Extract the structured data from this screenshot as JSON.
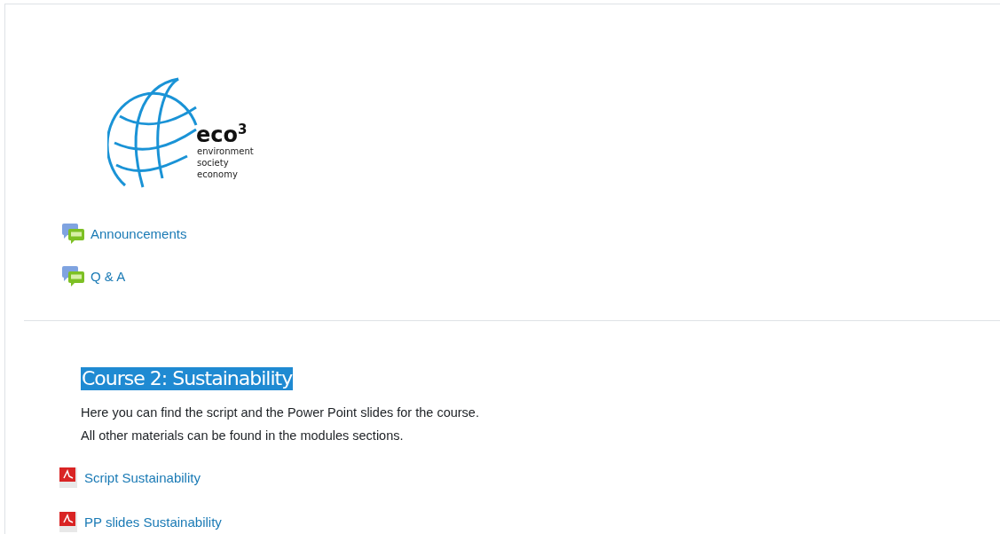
{
  "logo": {
    "name": "eco",
    "superscript": "3",
    "lines": [
      "environment",
      "society",
      "economy"
    ]
  },
  "forum_links": [
    {
      "kind": "forum",
      "label": "Announcements"
    },
    {
      "kind": "forum",
      "label": "Q & A"
    }
  ],
  "section": {
    "title": "Course 2: Sustainability",
    "selected": true,
    "summary": [
      "Here you can find the script and the Power Point slides for the course.",
      "All other materials can be found in the modules sections."
    ],
    "files": [
      {
        "kind": "pdf",
        "label": "Script Sustainability"
      },
      {
        "kind": "pdf",
        "label": "PP slides Sustainability"
      }
    ]
  }
}
